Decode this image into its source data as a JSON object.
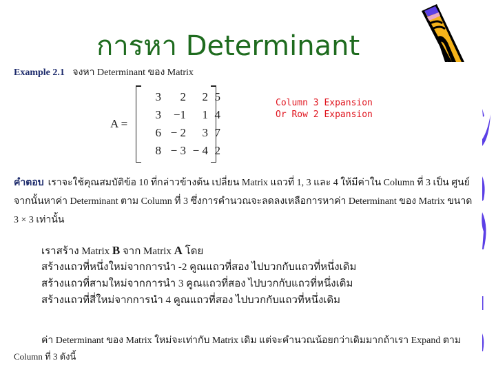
{
  "slide": {
    "title": "การหา Determinant",
    "example_label": "Example 2.1",
    "example_text": "จงหา Determinant ของ Matrix",
    "matrix": {
      "name": "A =",
      "rows": [
        [
          "3",
          "2",
          "2",
          "5"
        ],
        [
          "3",
          "−1",
          "1",
          "4"
        ],
        [
          "6",
          "− 2",
          "3",
          "7"
        ],
        [
          "8",
          "− 3",
          "− 4",
          "2"
        ]
      ]
    },
    "note_lines": [
      "Column 3 Expansion",
      "Or Row 2 Expansion"
    ],
    "answer_label": "คำตอบ",
    "answer_line1": "เราจะใช้คุณสมบัติข้อ 10 ที่กล่าวข้างต้น เปลี่ยน Matrix แถวที่ 1, 3 และ 4 ให้มีค่าใน Column ที่ 3 เป็น ศูนย์",
    "answer_line2": "จากนั้นหาค่า Determinant ตาม Column ที่ 3 ซึ่งการคำนวณจะลดลงเหลือการหาค่า Determinant ของ Matrix ขนาด",
    "answer_line3": "3 × 3 เท่านั้น",
    "steps_intro": {
      "prefix": "เราสร้าง Matrix ",
      "b": "B",
      "middle": " จาก Matrix ",
      "a": "A",
      "suffix": " โดย"
    },
    "steps": [
      "สร้างแถวที่หนึ่งใหม่จากการนำ -2 คูณแถวที่สอง ไปบวกกับแถวที่หนึ่งเดิม",
      "สร้างแถวที่สามใหม่จากการนำ  3 คูณแถวที่สอง ไปบวกกับแถวที่หนึ่งเดิม",
      "สร้างแถวที่สี่ใหม่จากการนำ 4 คูณแถวที่สอง ไปบวกกับแถวที่หนึ่งเดิม"
    ],
    "conclusion_line1": "ค่า Determinant ของ Matrix ใหม่จะเท่ากับ Matrix เดิม แต่จะคำนวณน้อยกว่าเดิมมากถ้าเรา Expand ตาม",
    "conclusion_line2": "Column ที่ 3 ดังนี้"
  },
  "colors": {
    "title": "#1e6b1e",
    "note": "#e0141e",
    "label": "#1c2a6b",
    "deco": "#5b3fe6"
  }
}
